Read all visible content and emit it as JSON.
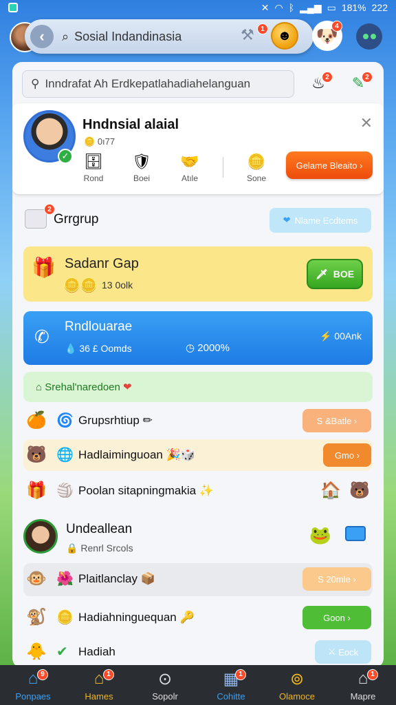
{
  "status": {
    "time": "222",
    "battery": "181%"
  },
  "header": {
    "search_text": "Sosial Indandinasia",
    "tool_badge": "1",
    "mascot_badge": "4"
  },
  "panel": {
    "search_text": "Inndrafat Ah Erdkepatlahadiahelanguan",
    "icon_badge_1": "2",
    "icon_badge_2": "2"
  },
  "profile": {
    "name": "Hndnsial alaial",
    "sub": "0ı77",
    "stats": [
      {
        "label": "Rond"
      },
      {
        "label": "Boei"
      },
      {
        "label": "Atıle"
      },
      {
        "label": "Sone"
      }
    ],
    "button": "Gelame Bleaito"
  },
  "group": {
    "label": "Grrgrup",
    "pill": "Nlame Ecdtems",
    "badge": "2"
  },
  "gap_card": {
    "title": "Sadanr Gap",
    "amount": "13 0olk",
    "button": "BOE"
  },
  "call_card": {
    "title": "Rndlouarae",
    "sub": "36 £ Oomds",
    "time": "2000%",
    "right": "00Ank"
  },
  "heart_row": {
    "text": "Srehal'naredoen"
  },
  "list": [
    {
      "label": "Grupsrhtiup",
      "pill": "S &Batle"
    },
    {
      "label": "Hadlaiminguoan",
      "pill": "Gmo"
    },
    {
      "label": "Poolan sitapningmakia"
    }
  ],
  "user": {
    "name": "Undeallean",
    "sub": "Renrl Srcols"
  },
  "list2": [
    {
      "label": "Plaitlanclay",
      "pill": "S 20mle"
    },
    {
      "label": "Hadiahninguequan",
      "pill": "Goon"
    },
    {
      "label": "Hadiah",
      "pill": "Eock"
    }
  ],
  "nav": [
    {
      "label": "Ponpaes",
      "badge": "9"
    },
    {
      "label": "Hames",
      "badge": "1"
    },
    {
      "label": "Sopolr"
    },
    {
      "label": "Cohitte",
      "badge": "1"
    },
    {
      "label": "Olamoce"
    },
    {
      "label": "Mapre",
      "badge": "1"
    }
  ],
  "colors": {
    "accent_orange": "#ee4c0c",
    "accent_blue": "#1e7be4",
    "accent_green": "#36a620",
    "yellow_card": "#fbe78a",
    "navbar": "#2a2e33"
  }
}
